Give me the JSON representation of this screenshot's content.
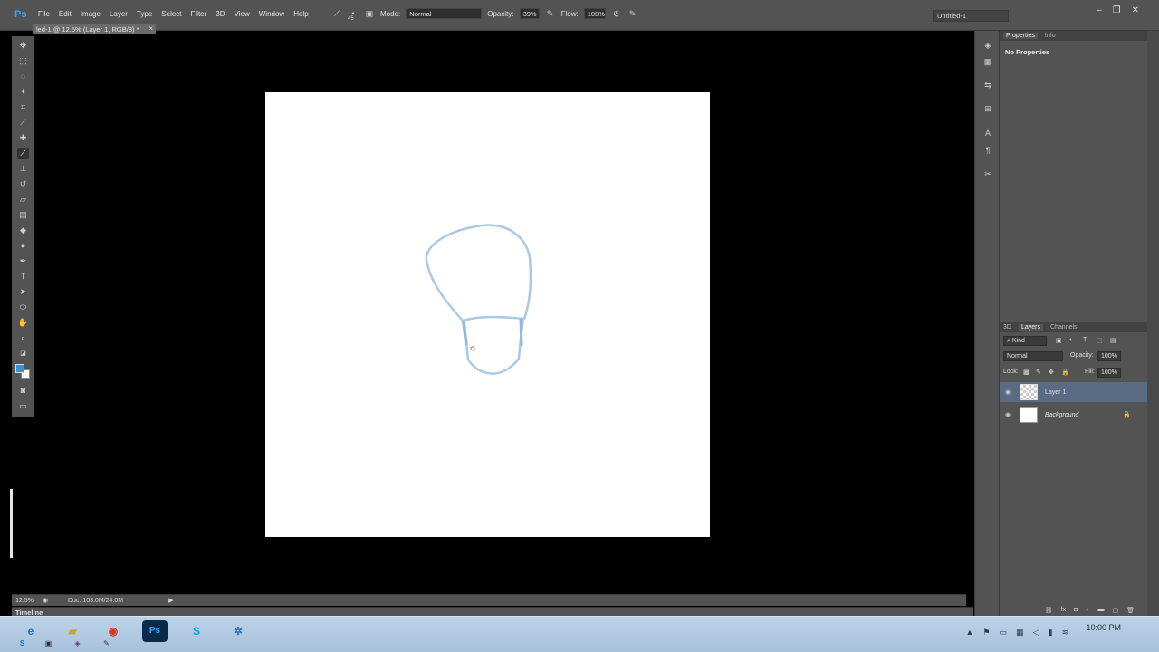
{
  "app": {
    "logo": "Ps",
    "menus": [
      "File",
      "Edit",
      "Image",
      "Layer",
      "Type",
      "Select",
      "Filter",
      "3D",
      "View",
      "Window",
      "Help"
    ],
    "workspace": "Untitled-1"
  },
  "options_bar": {
    "brush_size": "45",
    "mode_label": "Mode:",
    "mode_value": "Normal",
    "opacity_label": "Opacity:",
    "opacity_value": "39%",
    "flow_label": "Flow:",
    "flow_value": "100%"
  },
  "document": {
    "tab_title": "led-1 @ 12.5% (Layer 1, RGB/8) *",
    "zoom": "12.5%",
    "doc_info": "Doc: 103.0M/24.0M"
  },
  "timeline": {
    "label": "Timeline"
  },
  "properties_panel": {
    "tabs": [
      "Properties",
      "Info"
    ],
    "message": "No Properties"
  },
  "layers_panel": {
    "tabs": [
      "3D",
      "Layers",
      "Channels"
    ],
    "filter_kind": "Kind",
    "blend_mode": "Normal",
    "opacity_label": "Opacity:",
    "opacity_value": "100%",
    "lock_label": "Lock:",
    "fill_label": "Fill:",
    "fill_value": "100%",
    "layers": [
      {
        "name": "Layer 1",
        "selected": true
      },
      {
        "name": "Background",
        "selected": false,
        "locked": true
      }
    ]
  },
  "colors": {
    "foreground": "#3d8ed6",
    "background": "#ffffff",
    "sketch_stroke": "#a9c9e6"
  },
  "taskbar": {
    "clock_time": "10:00 PM",
    "apps": [
      "ie-icon",
      "folder-icon",
      "chrome-icon",
      "photoshop-icon",
      "skype-icon",
      "network-app-icon"
    ]
  }
}
